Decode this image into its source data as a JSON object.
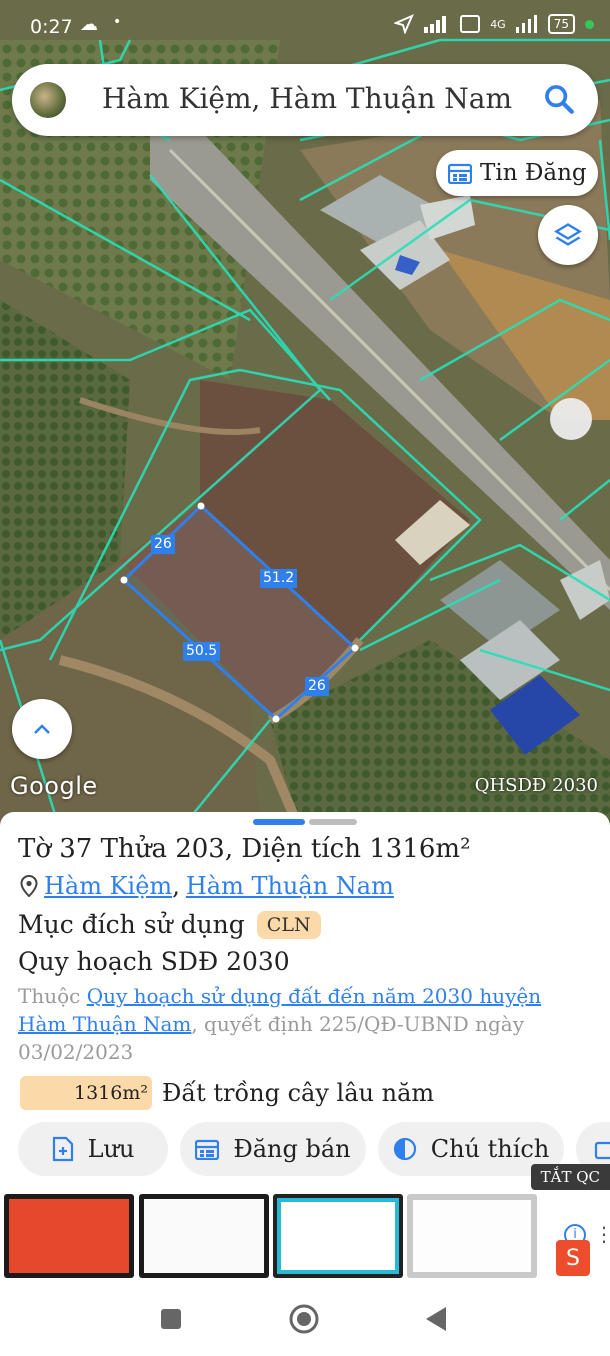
{
  "status_bar": {
    "time": "0:27",
    "network": "4G",
    "battery": "75"
  },
  "search": {
    "query": "Hàm Kiệm, Hàm Thuận Nam"
  },
  "map": {
    "tin_dang_label": "Tin Đăng",
    "logo": "Google",
    "layer_label": "QHSDĐ 2030",
    "parcel_edges": [
      "26",
      "51.2",
      "50.5",
      "26"
    ]
  },
  "parcel": {
    "title": "Tờ 37 Thửa 203, Diện tích 1316m²",
    "commune": "Hàm Kiệm",
    "separator": ",",
    "district": "Hàm Thuận Nam",
    "purpose_label": "Mục đích sử dụng",
    "purpose_code": "CLN",
    "plan_title": "Quy hoạch SDĐ 2030",
    "plan_prefix": "Thuộc",
    "plan_link": "Quy hoạch sử dụng đất đến năm 2030 huyện Hàm Thuận Nam",
    "plan_suffix": ", quyết định 225/QĐ-UBND ngày 03/02/2023",
    "area_value": "1316m²",
    "area_label": "Đất trồng cây lâu năm"
  },
  "actions": [
    {
      "label": "Lưu",
      "icon": "add-file-icon"
    },
    {
      "label": "Đăng bán",
      "icon": "calendar-icon"
    },
    {
      "label": "Chú thích",
      "icon": "contrast-icon"
    }
  ],
  "ad": {
    "close_label": "TẮT QC",
    "brand_icon": "shopee-icon"
  },
  "colors": {
    "accent": "#2f80ed",
    "badge": "#fcd9a8",
    "boundary": "#28e0b8"
  }
}
